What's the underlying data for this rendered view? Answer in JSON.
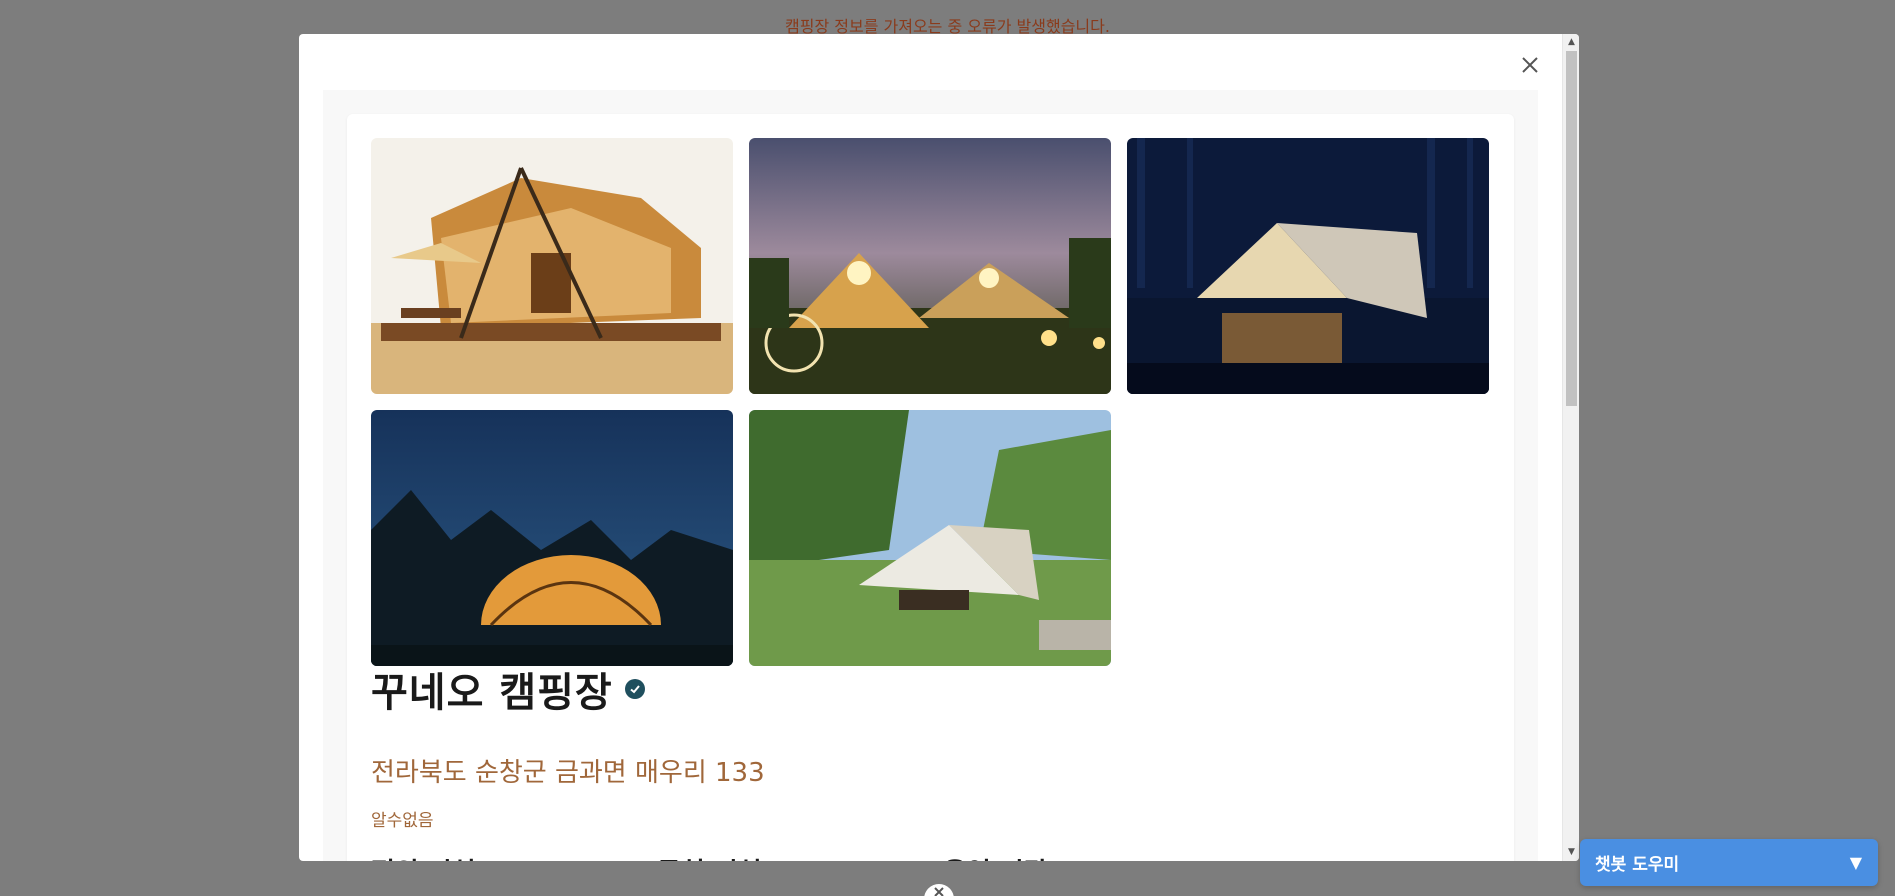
{
  "error_message": "캠핑장 정보를 가져오는 중 오류가 발생했습니다.",
  "modal": {
    "close_icon": "close-icon",
    "photos": [
      {
        "alt": "glamping-tent-deck-photo"
      },
      {
        "alt": "lit-tents-at-dusk-photo"
      },
      {
        "alt": "tent-by-water-at-night-photo"
      },
      {
        "alt": "dome-tent-night-sky-photo"
      },
      {
        "alt": "tarp-tent-in-forest-photo"
      }
    ],
    "campsite": {
      "name": "꾸네오 캠핑장",
      "verified_icon": "verified-check-icon",
      "address": "전라북도 순창군 금과면 매우리 133",
      "phone": "알수없음",
      "sections": [
        "편의 시설",
        "근처 시설",
        "운영 시간"
      ]
    }
  },
  "chatbot": {
    "label": "챗봇 도우미",
    "toggle_icon": "triangle-down-icon",
    "color": "#4a8fe2"
  },
  "colors": {
    "accent_text": "#a0673a",
    "error_text": "#8a3b1c",
    "verified_badge": "#1f4f5e"
  }
}
